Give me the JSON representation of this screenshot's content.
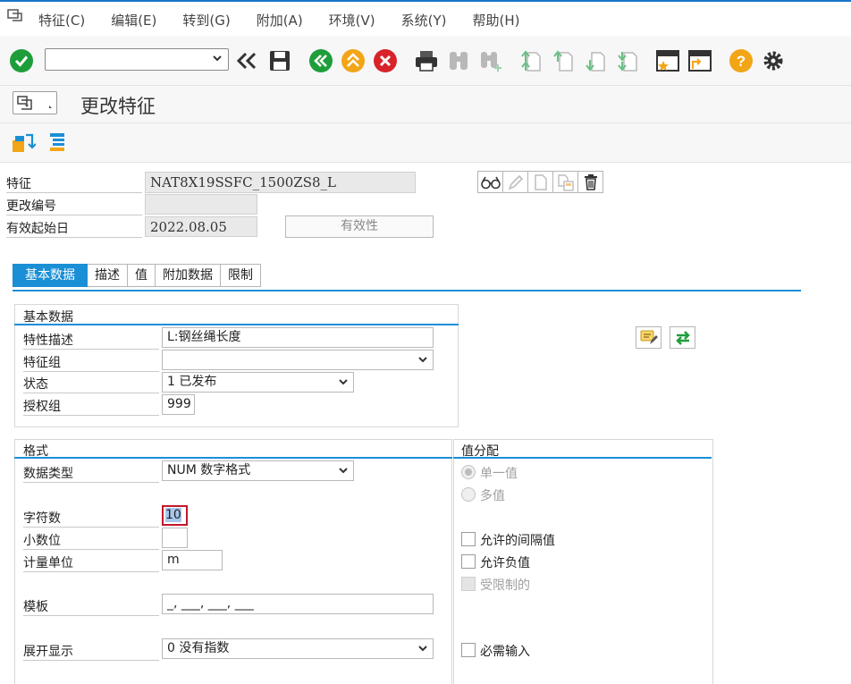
{
  "menu": {
    "items": [
      {
        "label": "特征(C)"
      },
      {
        "label": "编辑(E)"
      },
      {
        "label": "转到(G)"
      },
      {
        "label": "附加(A)"
      },
      {
        "label": "环境(V)"
      },
      {
        "label": "系统(Y)"
      },
      {
        "label": "帮助(H)"
      }
    ]
  },
  "toolbar": {
    "command_value": "",
    "icons": [
      "enter-icon",
      "command-field",
      "collapse-icon",
      "save-icon",
      "back-icon",
      "exit-icon",
      "cancel-icon",
      "print-icon",
      "find-icon",
      "find-next-icon",
      "first-page-icon",
      "previous-page-icon",
      "next-page-icon",
      "last-page-icon",
      "create-session-icon",
      "shortcut-icon",
      "help-icon",
      "settings-icon"
    ]
  },
  "title": {
    "text": "更改特征"
  },
  "header": {
    "characteristic_label": "特征",
    "characteristic_value": "NAT8X19SSFC_1500ZS8_L",
    "change_number_label": "更改编号",
    "change_number_value": "",
    "valid_from_label": "有效起始日",
    "valid_from_value": "2022.08.05",
    "validity_button": "有效性"
  },
  "tabs": [
    {
      "label": "基本数据",
      "active": true
    },
    {
      "label": "描述",
      "active": false
    },
    {
      "label": "值",
      "active": false
    },
    {
      "label": "附加数据",
      "active": false
    },
    {
      "label": "限制",
      "active": false
    }
  ],
  "basic_data": {
    "group_title": "基本数据",
    "description_label": "特性描述",
    "description_value": "L:钢丝绳长度",
    "chars_group_label": "特征组",
    "chars_group_value": "",
    "status_label": "状态",
    "status_value": "1 已发布",
    "auth_group_label": "授权组",
    "auth_group_value": "999"
  },
  "format": {
    "group_title": "格式",
    "data_type_label": "数据类型",
    "data_type_value": "NUM 数字格式",
    "num_chars_label": "字符数",
    "num_chars_value": "10",
    "decimals_label": "小数位",
    "decimals_value": "",
    "unit_label": "计量单位",
    "unit_value": "m",
    "template_label": "模板",
    "template_value": "_, ___, ___, ___",
    "exponent_label": "展开显示",
    "exponent_value": "0 没有指数"
  },
  "value_assignment": {
    "group_title": "值分配",
    "single_value": "单一值",
    "multiple_values": "多值",
    "interval_values": "允许的间隔值",
    "negative_values": "允许负值",
    "restricted": "受限制的",
    "required_entry": "必需输入"
  },
  "colors": {
    "accent": "#1a8fd6",
    "green": "#1e9e3a",
    "orange": "#f2a516",
    "red": "#d9232a"
  }
}
